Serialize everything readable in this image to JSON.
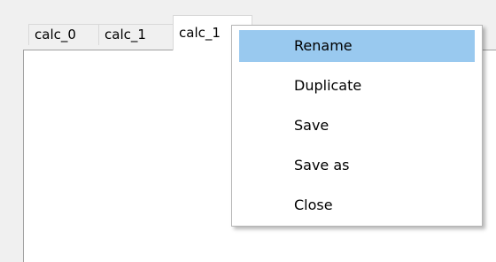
{
  "tabs": [
    {
      "label": "calc_0"
    },
    {
      "label": "calc_1"
    },
    {
      "label": "calc_1",
      "active": true
    }
  ],
  "context_menu": {
    "items": [
      {
        "label": "Rename",
        "highlighted": true
      },
      {
        "label": "Duplicate"
      },
      {
        "label": "Save"
      },
      {
        "label": "Save as"
      },
      {
        "label": "Close"
      }
    ]
  },
  "colors": {
    "window_bg": "#f0f0f0",
    "menu_highlight": "#99c9ef",
    "pane_bg": "#ffffff"
  }
}
